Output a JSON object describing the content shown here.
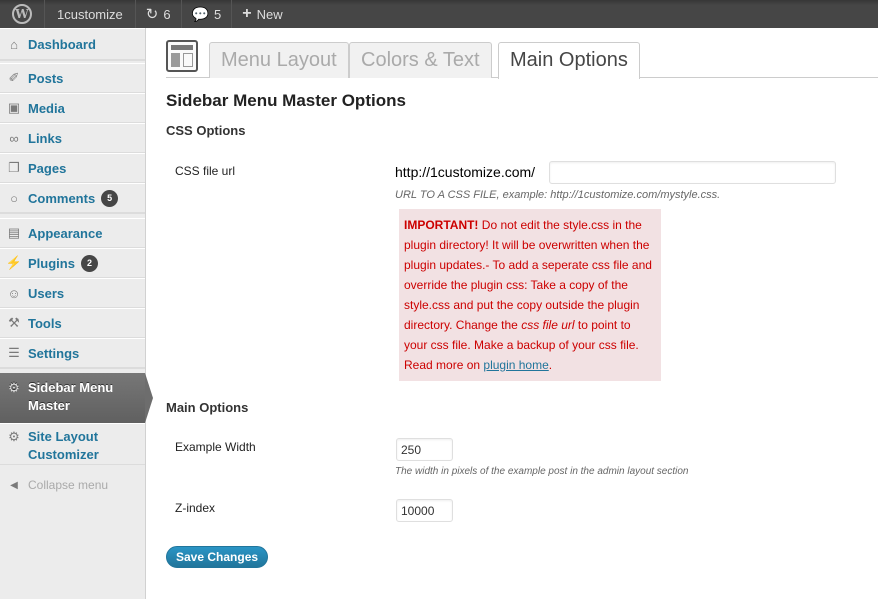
{
  "adminbar": {
    "site_name": "1customize",
    "updates_count": "6",
    "comments_count": "5",
    "new_label": "New"
  },
  "sidebar": {
    "items": [
      {
        "label": "Dashboard",
        "icon": "home-icon"
      },
      {
        "label": "Posts",
        "icon": "pin-icon"
      },
      {
        "label": "Media",
        "icon": "media-icon"
      },
      {
        "label": "Links",
        "icon": "link-icon"
      },
      {
        "label": "Pages",
        "icon": "pages-icon"
      },
      {
        "label": "Comments",
        "icon": "comment-icon",
        "badge": "5"
      },
      {
        "label": "Appearance",
        "icon": "appearance-icon"
      },
      {
        "label": "Plugins",
        "icon": "plugin-icon",
        "badge": "2"
      },
      {
        "label": "Users",
        "icon": "users-icon"
      },
      {
        "label": "Tools",
        "icon": "tools-icon"
      },
      {
        "label": "Settings",
        "icon": "settings-icon"
      },
      {
        "label": "Sidebar Menu Master",
        "line1": "Sidebar Menu",
        "line2": "Master",
        "icon": "gear-icon",
        "current": true
      },
      {
        "label": "Site Layout Customizer",
        "line1": "Site Layout",
        "line2": "Customizer",
        "icon": "gear-icon"
      }
    ],
    "collapse_label": "Collapse menu"
  },
  "tabs": [
    {
      "label": "Menu Layout",
      "active": false
    },
    {
      "label": "Colors & Text",
      "active": false
    },
    {
      "label": "Main Options",
      "active": true
    }
  ],
  "page": {
    "title": "Sidebar Menu Master Options",
    "css_section": "CSS Options",
    "css_file_label": "CSS file url",
    "css_prefix": "http://1customize.com/",
    "css_file_value": "",
    "css_desc": "URL TO A CSS FILE, example: http://1customize.com/mystyle.css.",
    "notice": {
      "strong": "IMPORTANT!",
      "part1": " Do not edit the style.css in the plugin directory! It will be overwritten when the plugin updates.- To add a seperate css file and override the plugin css: Take a copy of the style.css and put the copy outside the plugin directory. Change the ",
      "em": "css file url",
      "part2": " to point to your css file. Make a backup of your css file. Read more on ",
      "link": "plugin home",
      "end": "."
    },
    "main_section": "Main Options",
    "width_label": "Example Width",
    "width_value": "250",
    "width_desc": "The width in pixels of the example post in the admin layout section",
    "zindex_label": "Z-index",
    "zindex_value": "10000",
    "save_label": "Save Changes"
  },
  "colors": {
    "link": "#21759b",
    "adminbar": "#464646",
    "notice_bg": "#f2e1e3",
    "notice_text": "#cc0000"
  }
}
